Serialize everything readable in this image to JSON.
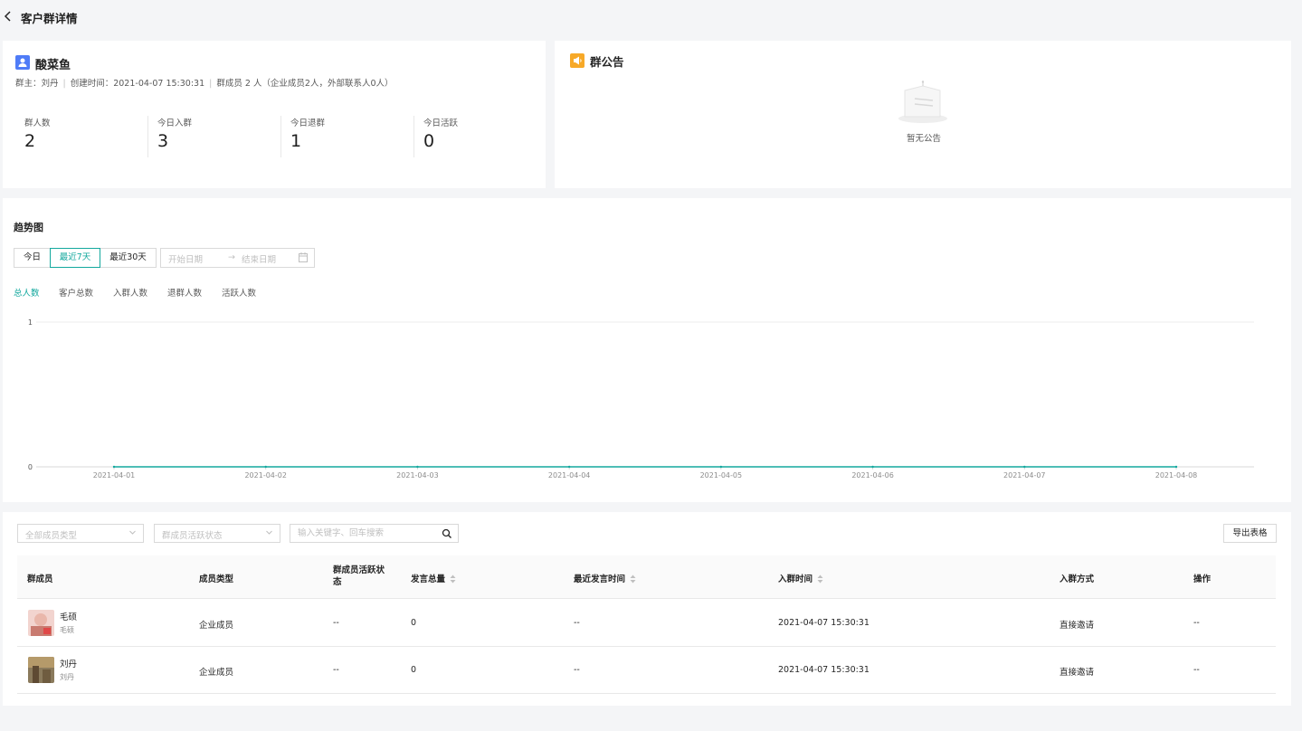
{
  "header": {
    "title": "客户群详情"
  },
  "group": {
    "name": "酸菜鱼",
    "owner": "群主：刘丹",
    "created": "创建时间：2021-04-07 15:30:31",
    "members": "群成员 2 人（企业成员2人，外部联系人0人）",
    "stats": [
      {
        "label": "群人数",
        "value": "2"
      },
      {
        "label": "今日入群",
        "value": "3"
      },
      {
        "label": "今日退群",
        "value": "1"
      },
      {
        "label": "今日活跃",
        "value": "0"
      }
    ]
  },
  "notice": {
    "title": "群公告",
    "empty": "暂无公告"
  },
  "trend": {
    "title": "趋势图",
    "ranges": [
      "今日",
      "最近7天",
      "最近30天"
    ],
    "active_range": "最近7天",
    "start_placeholder": "开始日期",
    "end_placeholder": "结束日期",
    "arrow": "→",
    "metrics": [
      "总人数",
      "客户总数",
      "入群人数",
      "退群人数",
      "活跃人数"
    ],
    "active_metric": "总人数"
  },
  "chart_data": {
    "type": "line",
    "x": [
      "2021-04-01",
      "2021-04-02",
      "2021-04-03",
      "2021-04-04",
      "2021-04-05",
      "2021-04-06",
      "2021-04-07",
      "2021-04-08"
    ],
    "series": [
      {
        "values": [
          0,
          0,
          0,
          0,
          0,
          0,
          0,
          0
        ],
        "color": "#13a89e"
      }
    ],
    "ylim": [
      0,
      1
    ],
    "yticks": [
      "0",
      "1"
    ],
    "grid": true,
    "legend": "none"
  },
  "members": {
    "filter_type_placeholder": "全部成员类型",
    "filter_status_placeholder": "群成员活跃状态",
    "search_placeholder": "输入关键字、回车搜索",
    "export_label": "导出表格",
    "columns": {
      "member": "群成员",
      "type": "成员类型",
      "status_line1": "群成员活跃状",
      "status_line2": "态",
      "messages": "发言总量",
      "last_message": "最近发言时间",
      "join_time": "入群时间",
      "join_method": "入群方式",
      "actions": "操作"
    },
    "rows": [
      {
        "name": "毛硕",
        "sub": "毛硕",
        "type": "企业成员",
        "status": "--",
        "messages": "0",
        "last_message": "--",
        "join_time": "2021-04-07 15:30:31",
        "join_method": "直接邀请",
        "actions": "--"
      },
      {
        "name": "刘丹",
        "sub": "刘丹",
        "type": "企业成员",
        "status": "--",
        "messages": "0",
        "last_message": "--",
        "join_time": "2021-04-07 15:30:31",
        "join_method": "直接邀请",
        "actions": "--"
      }
    ]
  }
}
